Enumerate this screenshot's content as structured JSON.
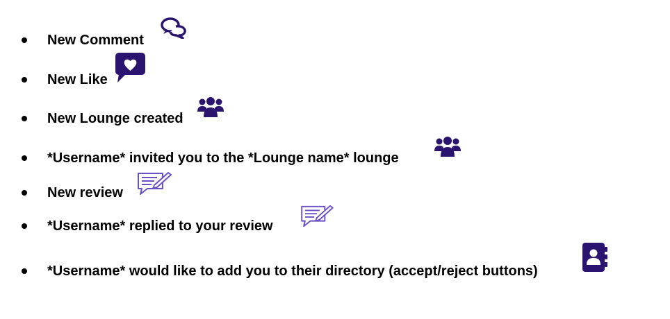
{
  "colors": {
    "text": "#000000",
    "icon_primary": "#2b1470",
    "icon_outline": "#6b4fc4"
  },
  "notifications": [
    {
      "label": "New Comment",
      "icon": "comment-bubbles-icon"
    },
    {
      "label": "New Like",
      "icon": "heart-speech-icon"
    },
    {
      "label": "New Lounge created",
      "icon": "group-users-icon"
    },
    {
      "label": "*Username* invited you to the *Lounge name* lounge",
      "icon": "group-users-icon"
    },
    {
      "label": "New review",
      "icon": "review-pen-icon"
    },
    {
      "label": "*Username* replied to your review",
      "icon": "review-pen-icon"
    },
    {
      "label": "*Username* would like to add you to their directory (accept/reject buttons)",
      "icon": "contact-book-icon"
    }
  ]
}
